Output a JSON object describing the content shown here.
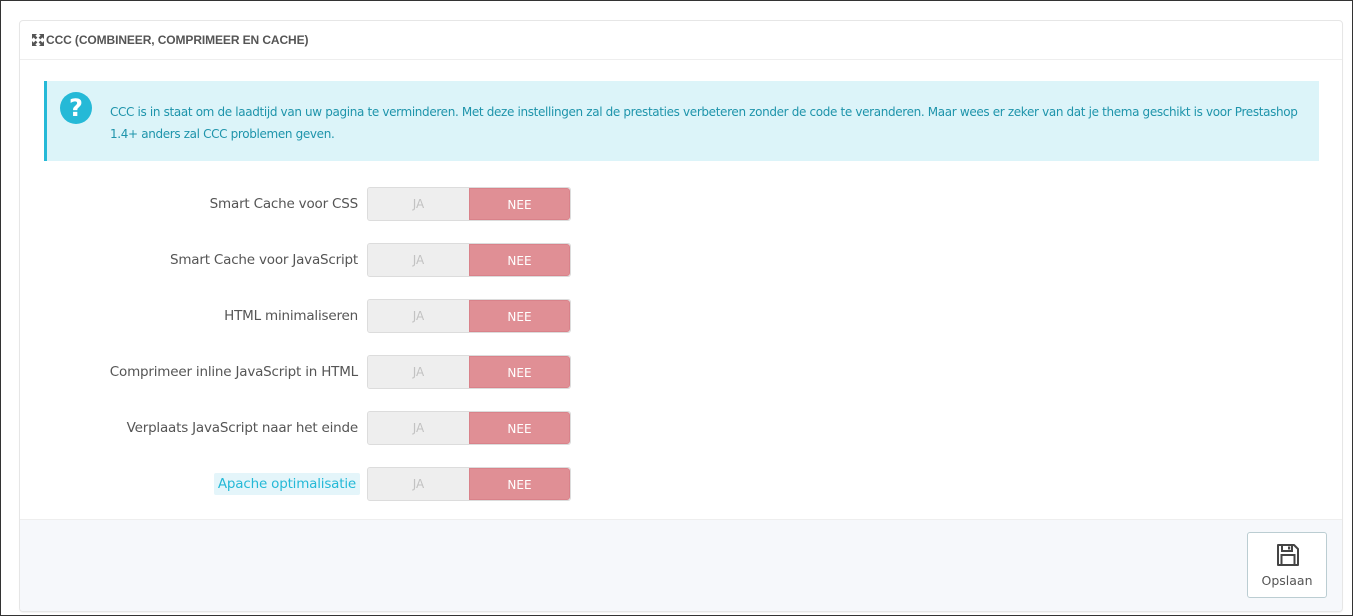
{
  "panel": {
    "title": "CCC (COMBINEER, COMPRIMEER EN CACHE)",
    "title_icon": "expand-arrows-icon"
  },
  "alert": {
    "icon": "question-circle-icon",
    "icon_glyph": "?",
    "text": "CCC is in staat om de laadtijd van uw pagina te verminderen. Met deze instellingen zal de prestaties verbeteren zonder de code te veranderen. Maar wees er zeker van dat je thema geschikt is voor Prestashop 1.4+ anders zal CCC problemen geven."
  },
  "settings": [
    {
      "label": "Smart Cache voor CSS",
      "yes_label": "JA",
      "no_label": "NEE",
      "value": "NEE"
    },
    {
      "label": "Smart Cache voor JavaScript",
      "yes_label": "JA",
      "no_label": "NEE",
      "value": "NEE"
    },
    {
      "label": "HTML minimaliseren",
      "yes_label": "JA",
      "no_label": "NEE",
      "value": "NEE"
    },
    {
      "label": "Comprimeer inline JavaScript in HTML",
      "yes_label": "JA",
      "no_label": "NEE",
      "value": "NEE"
    },
    {
      "label": "Verplaats JavaScript naar het einde",
      "yes_label": "JA",
      "no_label": "NEE",
      "value": "NEE"
    },
    {
      "label": "Apache optimalisatie",
      "yes_label": "JA",
      "no_label": "NEE",
      "value": "NEE"
    }
  ],
  "footer": {
    "save_label": "Opslaan",
    "save_icon": "floppy-disk-icon"
  },
  "colors": {
    "accent": "#25b9d7",
    "alert_bg": "#dcf4f9",
    "switch_off": "#e08f95",
    "switch_inactive": "#eeeeee",
    "footer_bg": "#f6f8fb"
  }
}
